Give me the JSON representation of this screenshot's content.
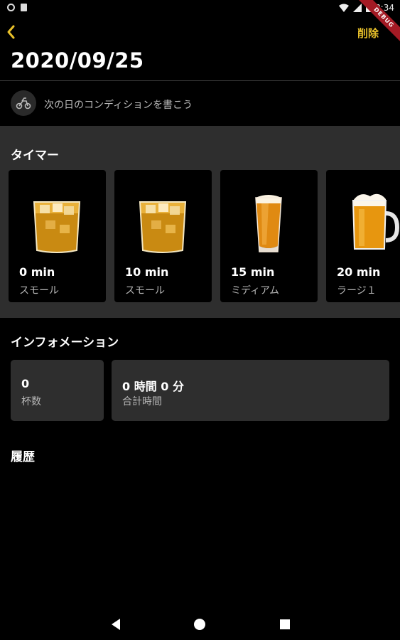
{
  "status_bar": {
    "time": "8:34",
    "debug_label": "DEBUG",
    "icons": [
      "notification-dot-icon",
      "sd-card-icon",
      "wifi-icon",
      "cellular-icon",
      "battery-icon"
    ]
  },
  "app_bar": {
    "back_icon": "chevron-left-icon",
    "delete_label": "削除",
    "accent_color": "#e9c12a"
  },
  "page": {
    "title": "2020/09/25"
  },
  "condition": {
    "icon": "motorbike-icon",
    "text": "次の日のコンディションを書こう"
  },
  "timer": {
    "title": "タイマー",
    "cards": [
      {
        "minutes": "0 min",
        "size": "スモール",
        "icon": "whiskey-glass-icon"
      },
      {
        "minutes": "10 min",
        "size": "スモール",
        "icon": "whiskey-glass-icon"
      },
      {
        "minutes": "15 min",
        "size": "ミディアム",
        "icon": "beer-glass-icon"
      },
      {
        "minutes": "20 min",
        "size": "ラージ１",
        "icon": "beer-mug-icon"
      }
    ]
  },
  "information": {
    "title": "インフォメーション",
    "cups": {
      "value": "0",
      "label": "杯数"
    },
    "total_time": {
      "value": "0 時間 0 分",
      "label": "合計時間"
    }
  },
  "history": {
    "title": "履歴"
  },
  "nav_bar": {
    "icons": [
      "nav-back-icon",
      "nav-home-icon",
      "nav-recents-icon"
    ]
  }
}
